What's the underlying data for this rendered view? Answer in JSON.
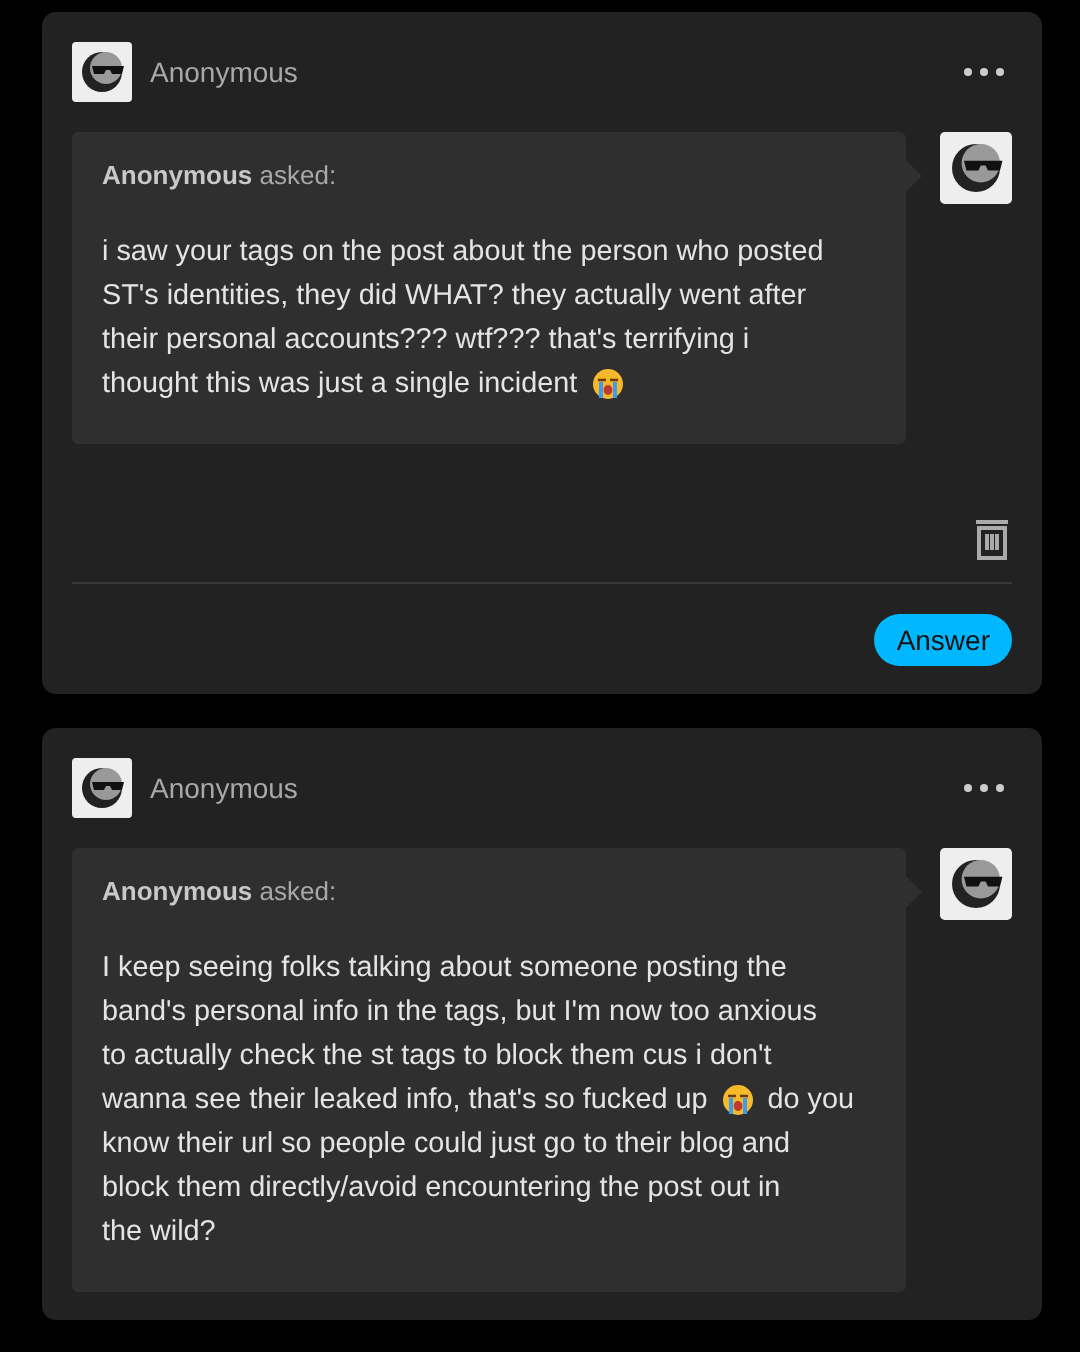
{
  "posts": [
    {
      "author": "Anonymous",
      "asker": "Anonymous",
      "asked_label": "asked:",
      "lines": [
        [
          {
            "kind": "text",
            "text": "i saw your tags on the post about the person who posted"
          }
        ],
        [
          {
            "kind": "text",
            "text": "ST's identities, they did WHAT? they actually went after"
          }
        ],
        [
          {
            "kind": "text",
            "text": "their personal accounts??? wtf??? that's terrifying i"
          }
        ],
        [
          {
            "kind": "text",
            "text": "thought this was just a single incident"
          },
          {
            "kind": "emoji"
          }
        ]
      ],
      "answer_button": "Answer"
    },
    {
      "author": "Anonymous",
      "asker": "Anonymous",
      "asked_label": "asked:",
      "lines": [
        [
          {
            "kind": "text",
            "text": "I keep seeing folks talking about someone posting the"
          }
        ],
        [
          {
            "kind": "text",
            "text": "band's personal info in the tags, but I'm now too anxious"
          }
        ],
        [
          {
            "kind": "text",
            "text": "to actually check the st tags to block them cus i don't"
          }
        ],
        [
          {
            "kind": "text",
            "text": "wanna see their leaked info, that's so fucked up"
          },
          {
            "kind": "emoji"
          },
          {
            "kind": "text",
            "text": "do you"
          }
        ],
        [
          {
            "kind": "text",
            "text": "know their url so people could just go to their blog and"
          }
        ],
        [
          {
            "kind": "text",
            "text": "block them directly/avoid encountering the post out in"
          }
        ],
        [
          {
            "kind": "text",
            "text": "the wild?"
          }
        ]
      ]
    }
  ]
}
